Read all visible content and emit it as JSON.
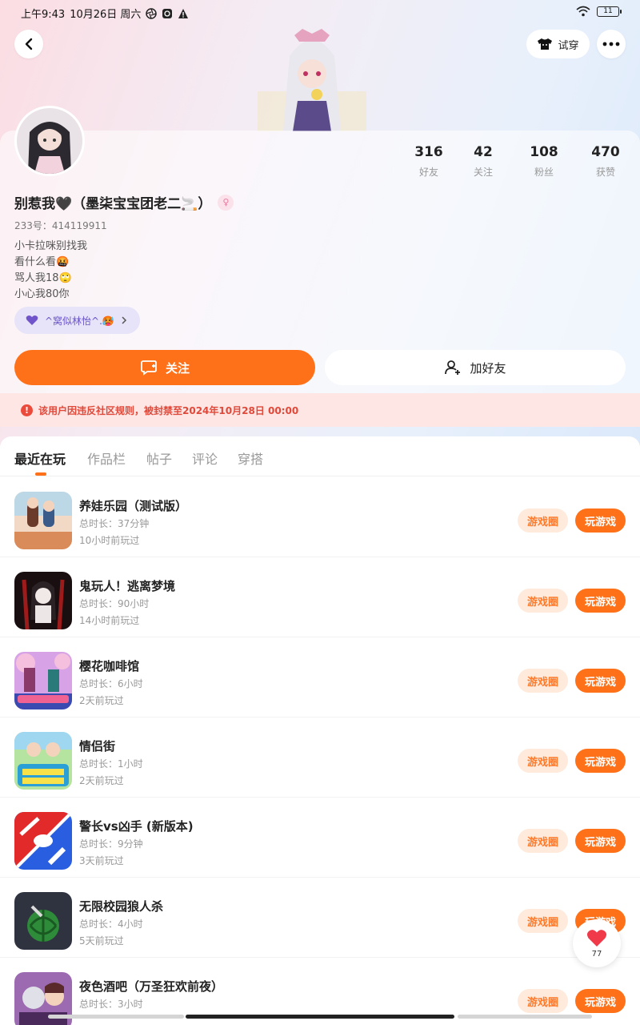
{
  "status_bar": {
    "time": "上午9:43",
    "date": "10月26日 周六",
    "battery": "11"
  },
  "header": {
    "try_on_label": "试穿"
  },
  "profile": {
    "username": "别惹我🖤（墨柒宝宝团老二🚬）",
    "uid": "233号：414119911",
    "bio": [
      "小卡拉咪别找我",
      "看什么看🤬",
      "骂人我18🙄",
      "小心我80你"
    ],
    "group_tag": "^窝似林怡^.🥵",
    "stats": [
      {
        "value": "316",
        "label": "好友"
      },
      {
        "value": "42",
        "label": "关注"
      },
      {
        "value": "108",
        "label": "粉丝"
      },
      {
        "value": "470",
        "label": "获赞"
      }
    ]
  },
  "actions": {
    "follow_label": "关注",
    "add_friend_label": "加好友"
  },
  "ban_notice": "该用户因违反社区规则，被封禁至2024年10月28日 00:00",
  "tabs": [
    {
      "label": "最近在玩",
      "active": true
    },
    {
      "label": "作品栏",
      "active": false
    },
    {
      "label": "帖子",
      "active": false
    },
    {
      "label": "评论",
      "active": false
    },
    {
      "label": "穿搭",
      "active": false
    }
  ],
  "games": [
    {
      "name": "养娃乐园（测试版）",
      "duration": "总时长：37分钟",
      "last_played": "10小时前玩过",
      "circle_label": "游戏圈",
      "play_label": "玩游戏",
      "icon_color": "#d98b5a"
    },
    {
      "name": "鬼玩人！逃离梦境",
      "duration": "总时长：90小时",
      "last_played": "14小时前玩过",
      "circle_label": "游戏圈",
      "play_label": "玩游戏",
      "icon_color": "#5a1414"
    },
    {
      "name": "樱花咖啡馆",
      "duration": "总时长：6小时",
      "last_played": "2天前玩过",
      "circle_label": "游戏圈",
      "play_label": "玩游戏",
      "icon_color": "#c48ad9"
    },
    {
      "name": "情侣街",
      "duration": "总时长：1小时",
      "last_played": "2天前玩过",
      "circle_label": "游戏圈",
      "play_label": "玩游戏",
      "icon_color": "#7fc97a"
    },
    {
      "name": "警长vs凶手 (新版本)",
      "duration": "总时长：9分钟",
      "last_played": "3天前玩过",
      "circle_label": "游戏圈",
      "play_label": "玩游戏",
      "icon_color": "#e32a2a"
    },
    {
      "name": "无限校园狼人杀",
      "duration": "总时长：4小时",
      "last_played": "5天前玩过",
      "circle_label": "游戏圈",
      "play_label": "玩游戏",
      "icon_color": "#2f3340"
    },
    {
      "name": "夜色酒吧（万圣狂欢前夜）",
      "duration": "总时长：3小时",
      "last_played": "",
      "circle_label": "游戏圈",
      "play_label": "玩游戏",
      "icon_color": "#9c6ab0"
    }
  ],
  "like_float": {
    "count": "77"
  }
}
